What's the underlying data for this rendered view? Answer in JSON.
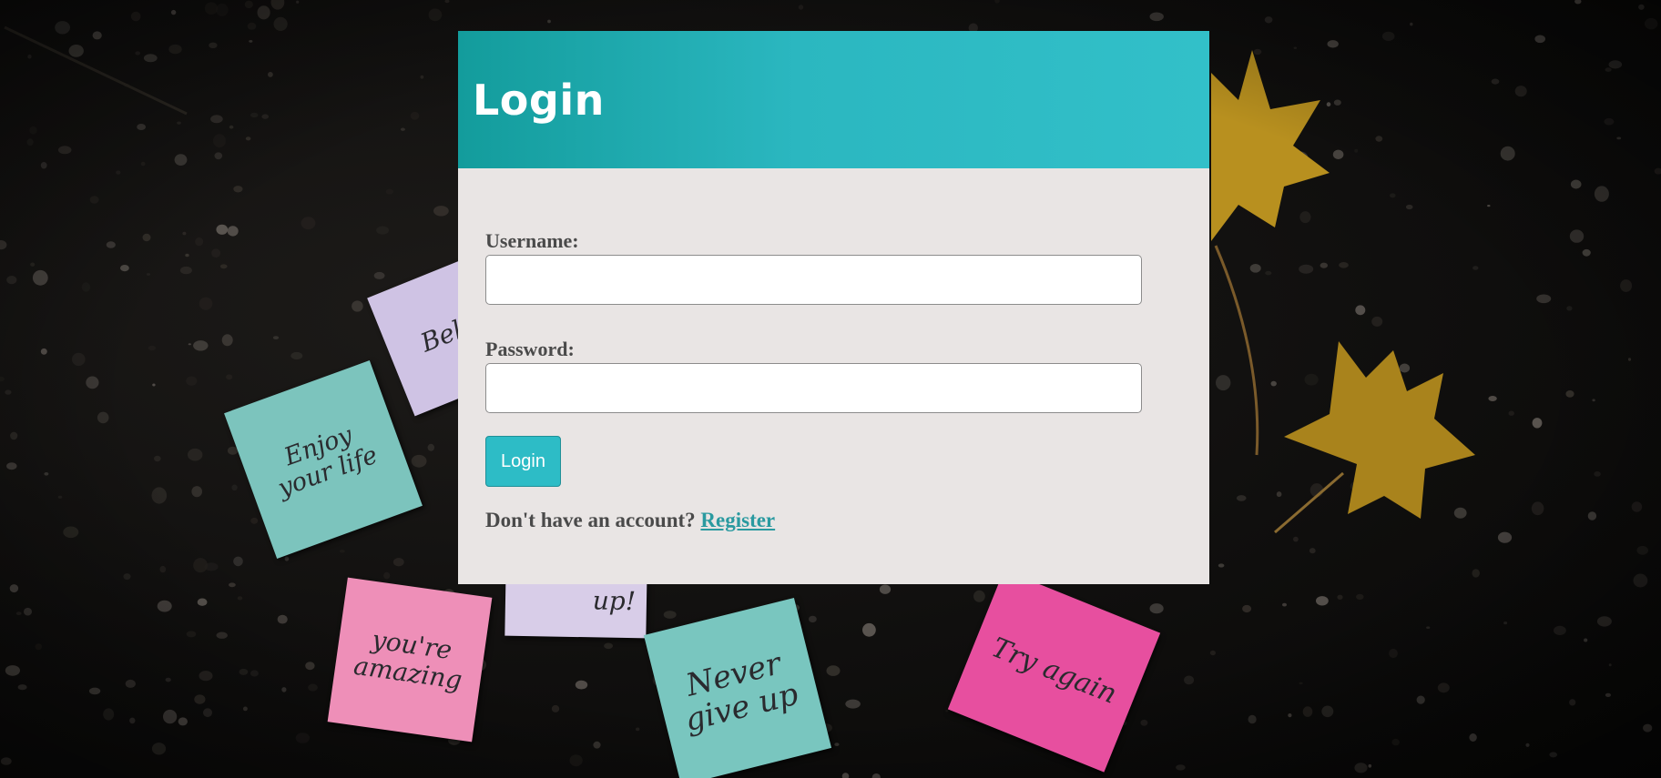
{
  "card": {
    "title": "Login",
    "header_gradient": [
      "#139c9c",
      "#32c0c9"
    ],
    "background": "#e9e5e4"
  },
  "form": {
    "username_label": "Username:",
    "username_value": "",
    "password_label": "Password:",
    "password_value": "",
    "login_button": "Login",
    "register_prompt": "Don't have an account?",
    "register_link": "Register"
  },
  "background_notes": [
    {
      "text": "Bel",
      "color": "#cfc3e4"
    },
    {
      "text": "Enjoy\nyour life",
      "color": "#7cc4bd"
    },
    {
      "text": "up!",
      "color": "#d8cde8"
    },
    {
      "text": "you're\namazing",
      "color": "#ee8fb8"
    },
    {
      "text": "Never\ngive up",
      "color": "#79c6bf"
    },
    {
      "text": "Try again",
      "color": "#e74f9f"
    }
  ],
  "colors": {
    "accent": "#2dbcc6",
    "link": "#2a9aa0",
    "label_text": "#4a4a4a"
  }
}
